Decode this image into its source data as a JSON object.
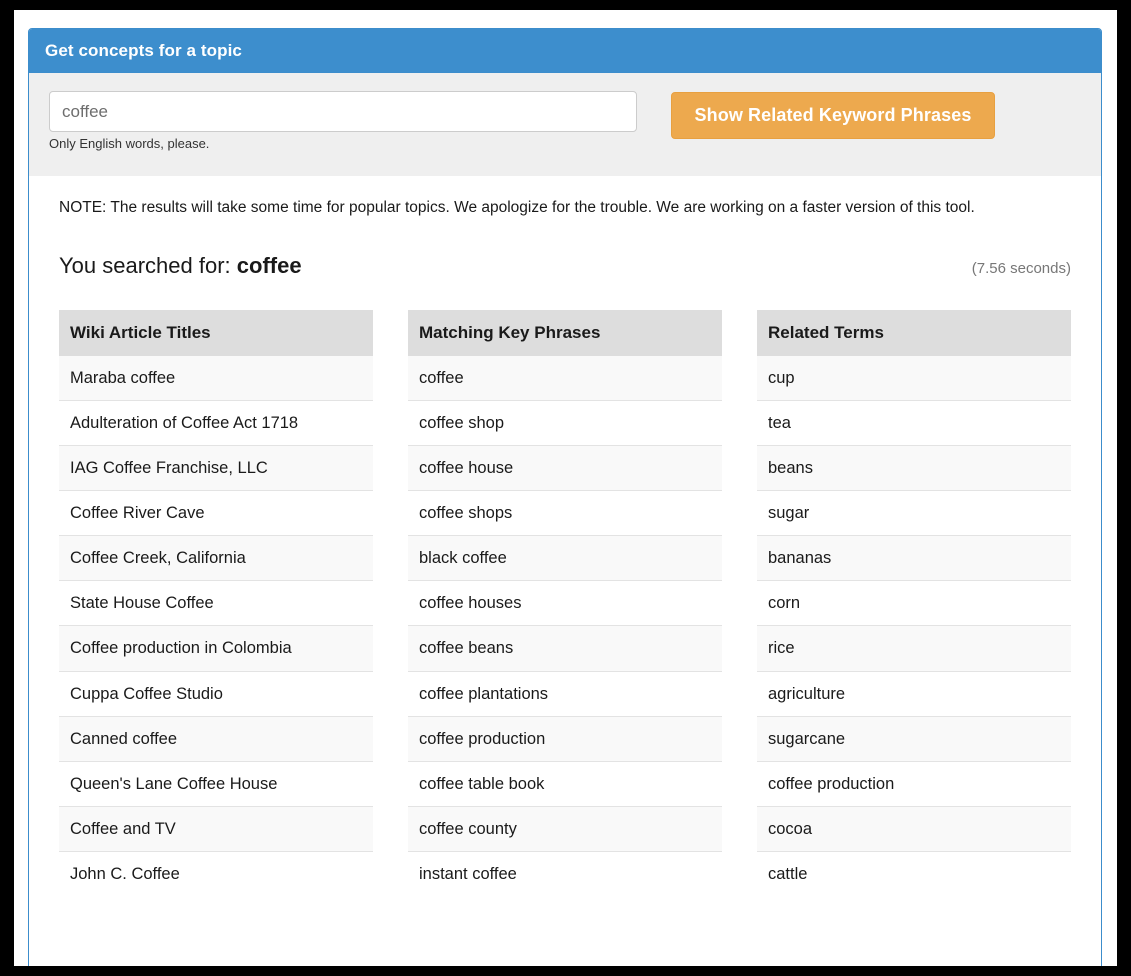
{
  "panel": {
    "title": "Get concepts for a topic"
  },
  "form": {
    "input_value": "coffee",
    "input_placeholder": "coffee",
    "help_text": "Only English words, please.",
    "submit_label": "Show Related Keyword Phrases"
  },
  "body": {
    "note": "NOTE: The results will take some time for popular topics. We apologize for the trouble. We are working on a faster version of this tool.",
    "searched_prefix": "You searched for:",
    "searched_term": "coffee",
    "elapsed": "(7.56 seconds)"
  },
  "colors": {
    "panel_header_blue": "#3d8ecd",
    "button_orange": "#eda94e",
    "form_well_gray": "#efefef",
    "table_header_gray": "#dddddd",
    "row_stripe_gray": "#f9f9f9",
    "frame_black": "#000000"
  },
  "tables": [
    {
      "header": "Wiki Article Titles",
      "rows": [
        "Maraba coffee",
        "Adulteration of Coffee Act 1718",
        "IAG Coffee Franchise, LLC",
        "Coffee River Cave",
        "Coffee Creek, California",
        "State House Coffee",
        "Coffee production in Colombia",
        "Cuppa Coffee Studio",
        "Canned coffee",
        "Queen's Lane Coffee House",
        "Coffee and TV",
        "John C. Coffee"
      ]
    },
    {
      "header": "Matching Key Phrases",
      "rows": [
        "coffee",
        "coffee shop",
        "coffee house",
        "coffee shops",
        "black coffee",
        "coffee houses",
        "coffee beans",
        "coffee plantations",
        "coffee production",
        "coffee table book",
        "coffee county",
        "instant coffee"
      ]
    },
    {
      "header": "Related Terms",
      "rows": [
        "cup",
        "tea",
        "beans",
        "sugar",
        "bananas",
        "corn",
        "rice",
        "agriculture",
        "sugarcane",
        "coffee production",
        "cocoa",
        "cattle"
      ]
    }
  ]
}
